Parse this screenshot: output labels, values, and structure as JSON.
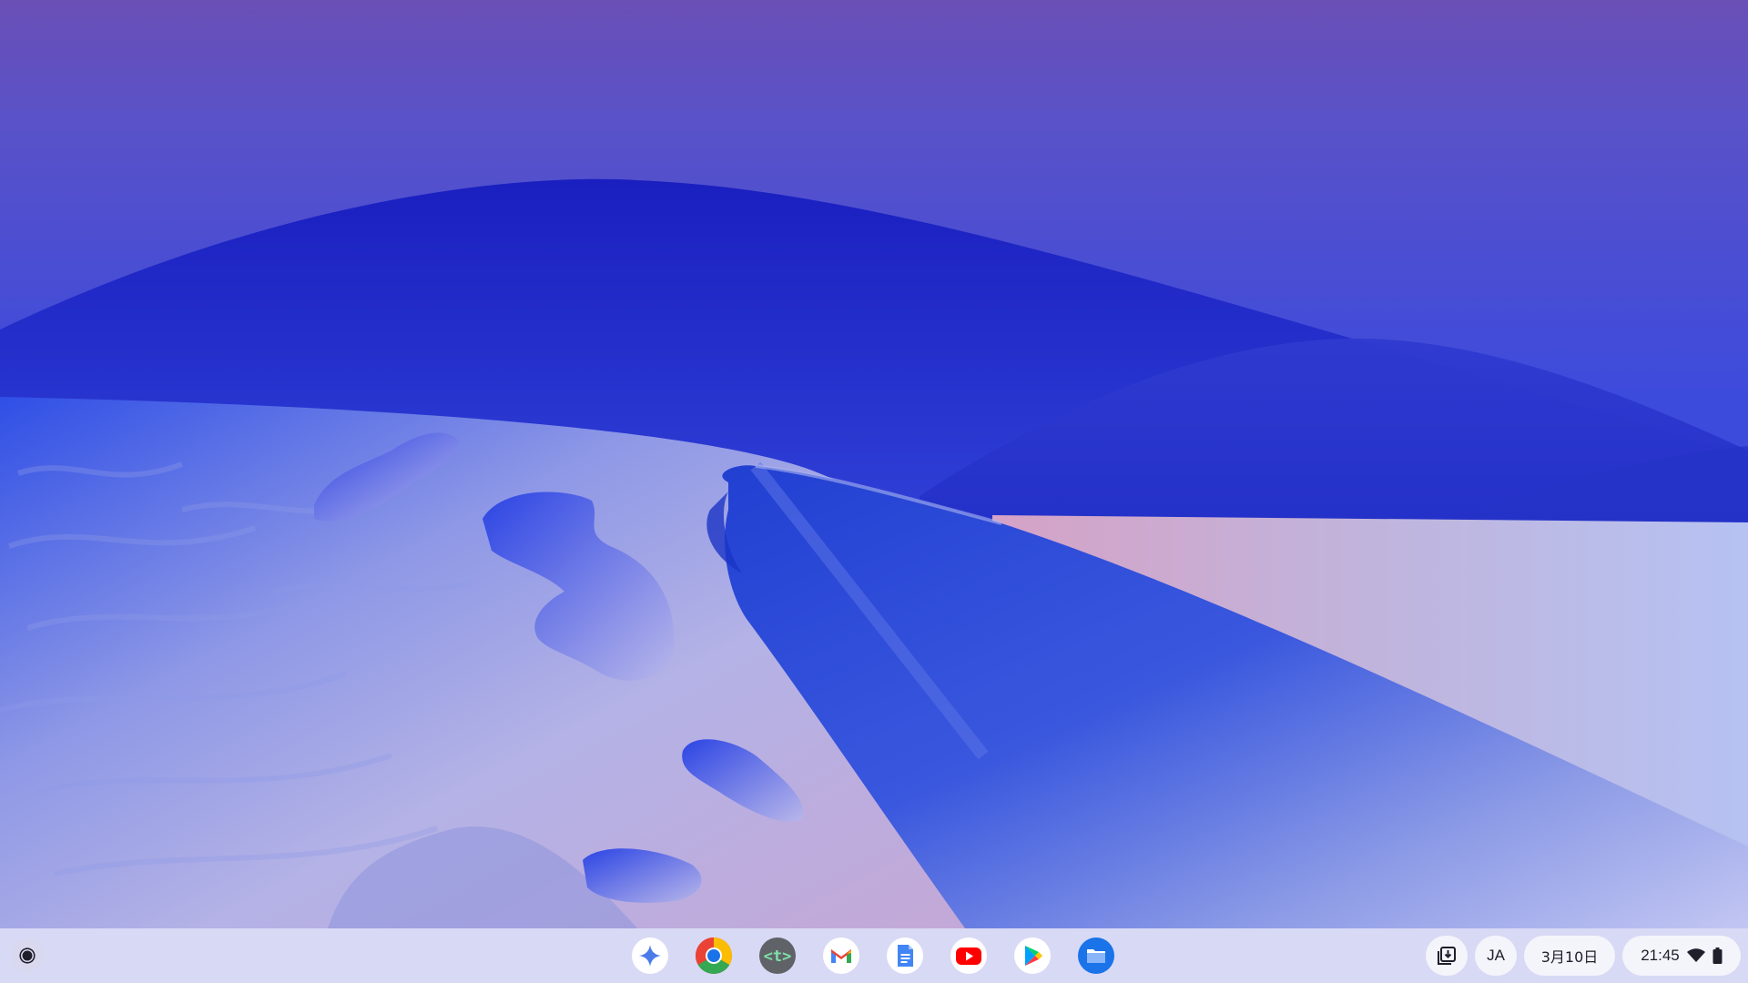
{
  "colors": {
    "shelf_background": "#e4e4f6",
    "accent": "#1a73e8"
  },
  "shelf": {
    "launcher": {
      "icon": "launcher-icon"
    },
    "apps": [
      {
        "name": "gemini",
        "icon": "gemini-icon"
      },
      {
        "name": "chrome",
        "icon": "chrome-icon"
      },
      {
        "name": "terminal",
        "icon": "terminal-icon",
        "label": "<t>"
      },
      {
        "name": "gmail",
        "icon": "gmail-icon"
      },
      {
        "name": "docs",
        "icon": "docs-icon"
      },
      {
        "name": "youtube",
        "icon": "youtube-icon"
      },
      {
        "name": "play-store",
        "icon": "play-store-icon"
      },
      {
        "name": "files",
        "icon": "files-icon"
      }
    ]
  },
  "tray": {
    "holding_space_icon": "holding-space-icon",
    "ime_label": "JA",
    "date": "3月10日",
    "time": "21:45",
    "wifi_icon": "wifi-icon",
    "battery_icon": "battery-icon"
  }
}
